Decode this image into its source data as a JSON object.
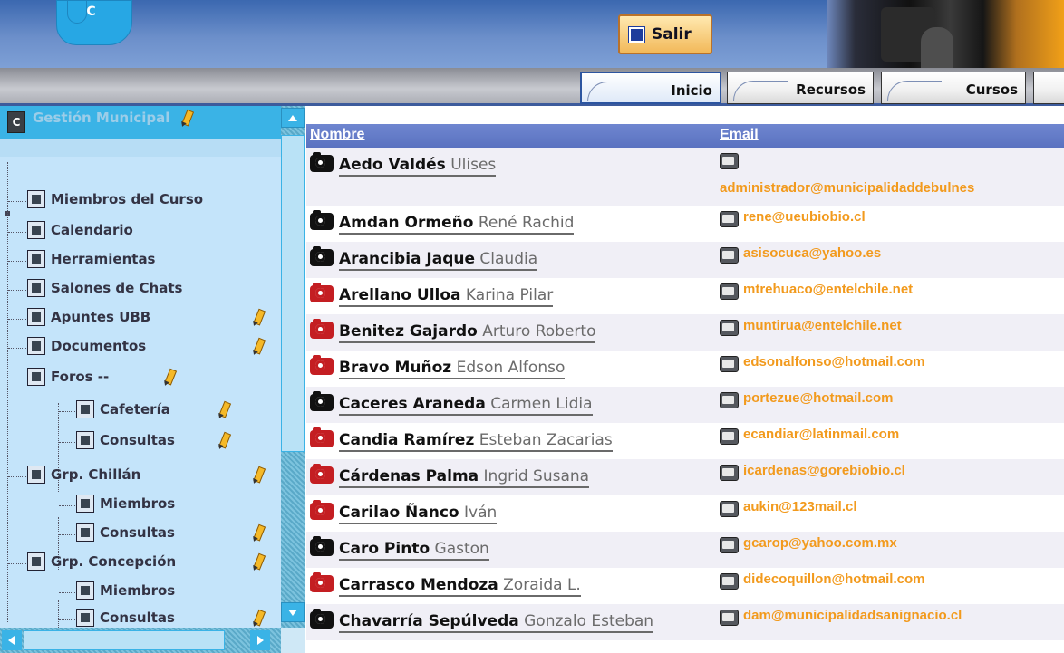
{
  "header": {
    "logo_text": "EVC",
    "salir_label": "Salir"
  },
  "tabs": [
    {
      "label": "Inicio",
      "active": true
    },
    {
      "label": "Recursos",
      "active": false
    },
    {
      "label": "Cursos",
      "active": false
    }
  ],
  "sidebar": {
    "course_title": "Gestión Municipal",
    "items": [
      {
        "label": "Miembros del Curso",
        "icon": "person-icon"
      },
      {
        "label": "Calendario",
        "icon": "calendar-icon"
      },
      {
        "label": "Herramientas",
        "icon": "tools-icon"
      },
      {
        "label": "Salones de Chats",
        "icon": "chat-icon"
      },
      {
        "label": "Apuntes UBB",
        "icon": "notes-icon"
      },
      {
        "label": "Documentos",
        "icon": "documents-icon"
      },
      {
        "label": "Foros --",
        "icon": "folder-icon"
      },
      {
        "label": "Cafetería",
        "icon": "speech-bubble-icon"
      },
      {
        "label": "Consultas",
        "icon": "forum-list-icon"
      },
      {
        "label": "Grp. Chillán",
        "icon": "group-icon"
      },
      {
        "label": "Miembros",
        "icon": "person-icon"
      },
      {
        "label": "Consultas",
        "icon": "forum-list-icon"
      },
      {
        "label": "Grp. Concepción",
        "icon": "group-icon"
      },
      {
        "label": "Miembros",
        "icon": "person-icon"
      },
      {
        "label": "Consultas",
        "icon": "forum-list-icon"
      }
    ]
  },
  "table": {
    "columns": [
      "Nombre",
      "Email"
    ],
    "rows": [
      {
        "surname": "Aedo Valdés",
        "given": "Ulises",
        "email": "administrador@municipalidaddebulnes",
        "status": "dark"
      },
      {
        "surname": "Amdan Ormeño",
        "given": "René Rachid",
        "email": "rene@ueubiobio.cl",
        "status": "dark"
      },
      {
        "surname": "Arancibia Jaque",
        "given": "Claudia",
        "email": "asisocuca@yahoo.es",
        "status": "dark"
      },
      {
        "surname": "Arellano Ulloa",
        "given": "Karina Pilar",
        "email": "mtrehuaco@entelchile.net",
        "status": "red"
      },
      {
        "surname": "Benitez Gajardo",
        "given": "Arturo Roberto",
        "email": "muntirua@entelchile.net",
        "status": "red"
      },
      {
        "surname": "Bravo Muñoz",
        "given": "Edson Alfonso",
        "email": "edsonalfonso@hotmail.com",
        "status": "red"
      },
      {
        "surname": "Caceres Araneda",
        "given": "Carmen Lidia",
        "email": "portezue@hotmail.com",
        "status": "dark"
      },
      {
        "surname": "Candia Ramírez",
        "given": "Esteban Zacarias",
        "email": "ecandiar@latinmail.com",
        "status": "red"
      },
      {
        "surname": "Cárdenas Palma",
        "given": "Ingrid Susana",
        "email": "icardenas@gorebiobio.cl",
        "status": "red"
      },
      {
        "surname": "Carilao Ñanco",
        "given": "Iván",
        "email": "aukin@123mail.cl",
        "status": "red"
      },
      {
        "surname": "Caro Pinto",
        "given": "Gaston",
        "email": "gcarop@yahoo.com.mx",
        "status": "dark"
      },
      {
        "surname": "Carrasco Mendoza",
        "given": "Zoraida L.",
        "email": "didecoquillon@hotmail.com",
        "status": "red"
      },
      {
        "surname": "Chavarría Sepúlveda",
        "given": "Gonzalo Esteban",
        "email": "dam@municipalidadsanignacio.cl",
        "status": "dark"
      }
    ]
  },
  "colors": {
    "email_orange": "#f29a1d",
    "header_blue": "#5a72c0",
    "sidebar_bg": "#c4e4fa",
    "accent_cyan": "#3ab3e6"
  }
}
